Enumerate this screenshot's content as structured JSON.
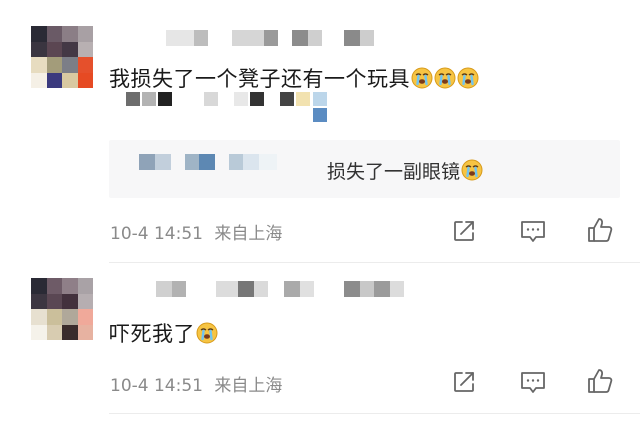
{
  "comments": [
    {
      "text": "我损失了一个凳子还有一个玩具",
      "emoji": [
        "crying-face-emoji",
        "crying-face-emoji",
        "crying-face-emoji"
      ],
      "reply": {
        "text": "损失了一副眼镜",
        "emoji": [
          "crying-face-emoji"
        ]
      },
      "timestamp": "10-4 14:51",
      "location": "来自上海"
    },
    {
      "text": "吓死我了",
      "emoji": [
        "crying-face-emoji"
      ],
      "timestamp": "10-4 14:51",
      "location": "来自上海"
    }
  ],
  "actions": [
    "share-icon",
    "comment-icon",
    "like-icon"
  ],
  "colors": {
    "text": "#1a1a1a",
    "meta": "#8a8a8a",
    "reply_bg": "#f7f7f8",
    "icon": "#666666"
  }
}
